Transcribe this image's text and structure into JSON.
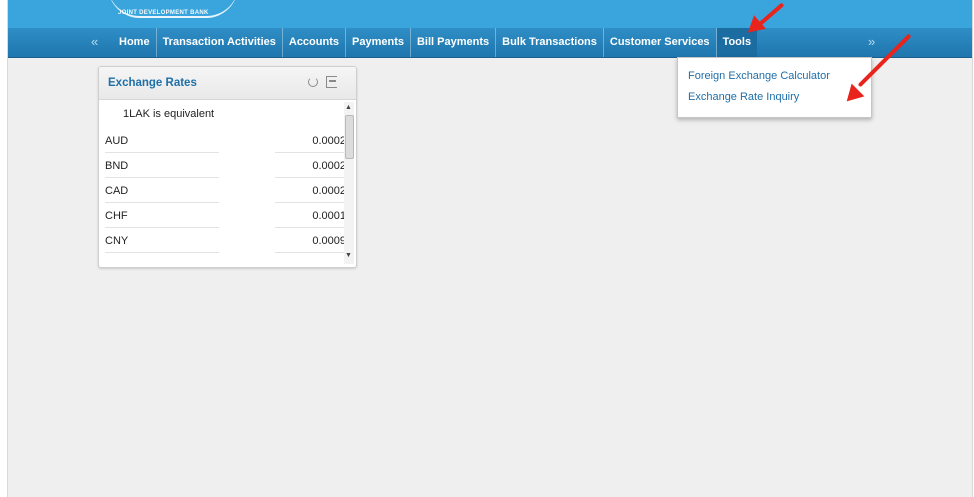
{
  "header": {
    "bank_name": "JOINT DEVELOPMENT BANK"
  },
  "nav": {
    "prev_arrow": "«",
    "next_arrow": "»",
    "items": [
      {
        "label": "Home"
      },
      {
        "label": "Transaction Activities"
      },
      {
        "label": "Accounts"
      },
      {
        "label": "Payments"
      },
      {
        "label": "Bill Payments"
      },
      {
        "label": "Bulk Transactions"
      },
      {
        "label": "Customer Services"
      },
      {
        "label": "Tools"
      }
    ]
  },
  "tools_menu": {
    "items": [
      {
        "label": "Foreign Exchange Calculator"
      },
      {
        "label": "Exchange Rate Inquiry"
      }
    ]
  },
  "exchange_widget": {
    "title": "Exchange Rates",
    "caption": "1LAK is equivalent",
    "rates": [
      {
        "code": "AUD",
        "value": "0.0002"
      },
      {
        "code": "BND",
        "value": "0.0002"
      },
      {
        "code": "CAD",
        "value": "0.0002"
      },
      {
        "code": "CHF",
        "value": "0.0001"
      },
      {
        "code": "CNY",
        "value": "0.0009"
      }
    ]
  },
  "colors": {
    "brand_blue": "#3aa5dd",
    "nav_blue": "#1e76ad",
    "link_blue": "#1f6fa8",
    "annotation_red": "#e8241c"
  },
  "icons": [
    "refresh-icon",
    "pin-icon",
    "scroll-up-icon",
    "scroll-down-icon"
  ]
}
